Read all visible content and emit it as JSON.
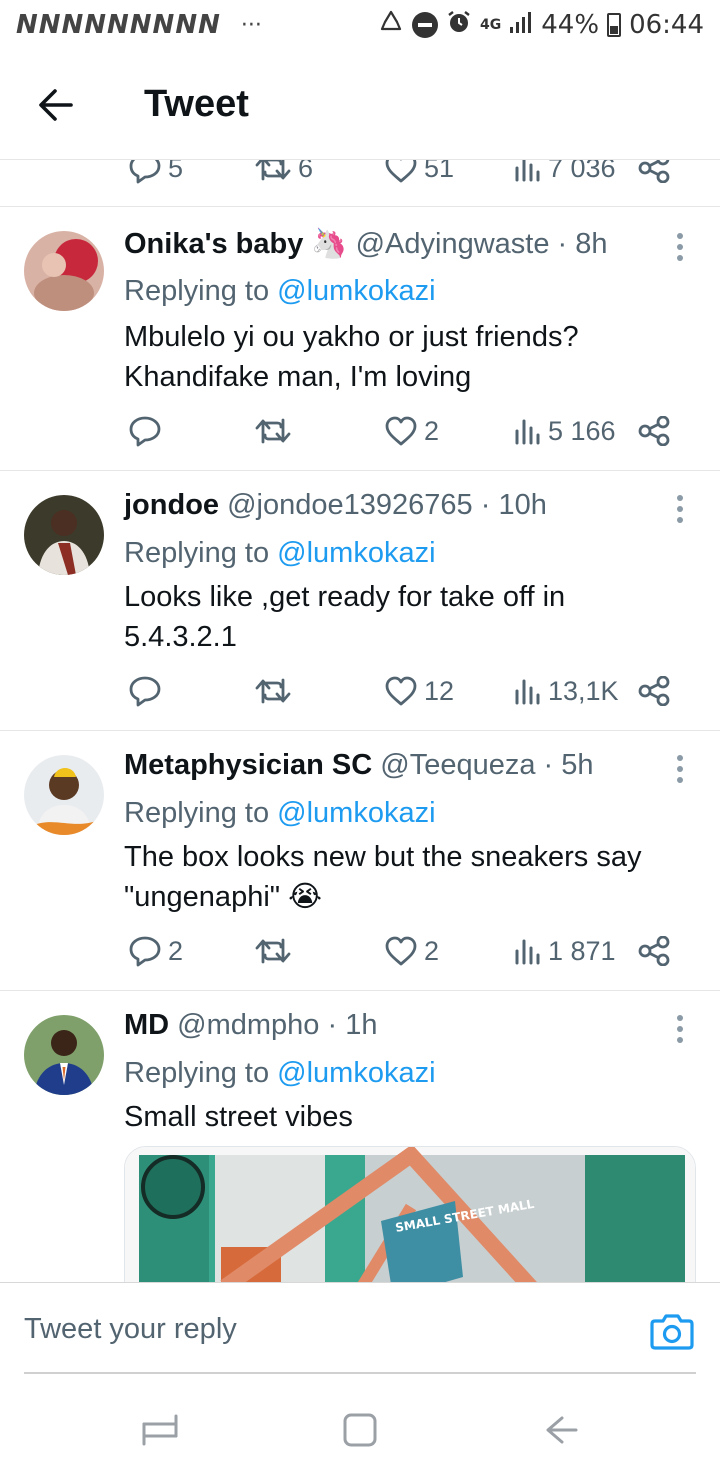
{
  "status_bar": {
    "notification_icons": "NNNNNNNNN",
    "more": "···",
    "network": "4G",
    "battery": "44%",
    "time": "06:44"
  },
  "header": {
    "title": "Tweet"
  },
  "partial_tweet": {
    "replies": "5",
    "retweets": "6",
    "likes": "51",
    "views": "7 036"
  },
  "tweets": [
    {
      "name": "Onika's baby 🦄",
      "handle": "@Adyingwaste",
      "time": "8h",
      "replying_prefix": "Replying to ",
      "replying_to": "@lumkokazi",
      "text": "Mbulelo yi ou yakho or just friends?\nKhandifake man,  I'm loving",
      "replies": "",
      "retweets": "",
      "likes": "2",
      "views": "5 166"
    },
    {
      "name": "jondoe",
      "handle": "@jondoe13926765",
      "time": "10h",
      "replying_prefix": "Replying to ",
      "replying_to": "@lumkokazi",
      "text": "Looks like ,get ready for take off in\n5.4.3.2.1",
      "replies": "",
      "retweets": "",
      "likes": "12",
      "views": "13,1K"
    },
    {
      "name": "Metaphysician SC",
      "handle": "@Teequeza",
      "time": "5h",
      "replying_prefix": "Replying to ",
      "replying_to": "@lumkokazi",
      "text": "The box looks new but the sneakers say\n\"ungenaphi\" 😭",
      "replies": "2",
      "retweets": "",
      "likes": "2",
      "views": "1 871"
    },
    {
      "name": "MD",
      "handle": "@mdmpho",
      "time": "1h",
      "replying_prefix": "Replying to ",
      "replying_to": "@lumkokazi",
      "text": "Small street vibes",
      "media_sign": "SMALL STREET MALL"
    }
  ],
  "reply_bar": {
    "placeholder": "Tweet your reply"
  },
  "colors": {
    "accent": "#1d9bf0",
    "text": "#0f1419",
    "secondary": "#536471"
  }
}
